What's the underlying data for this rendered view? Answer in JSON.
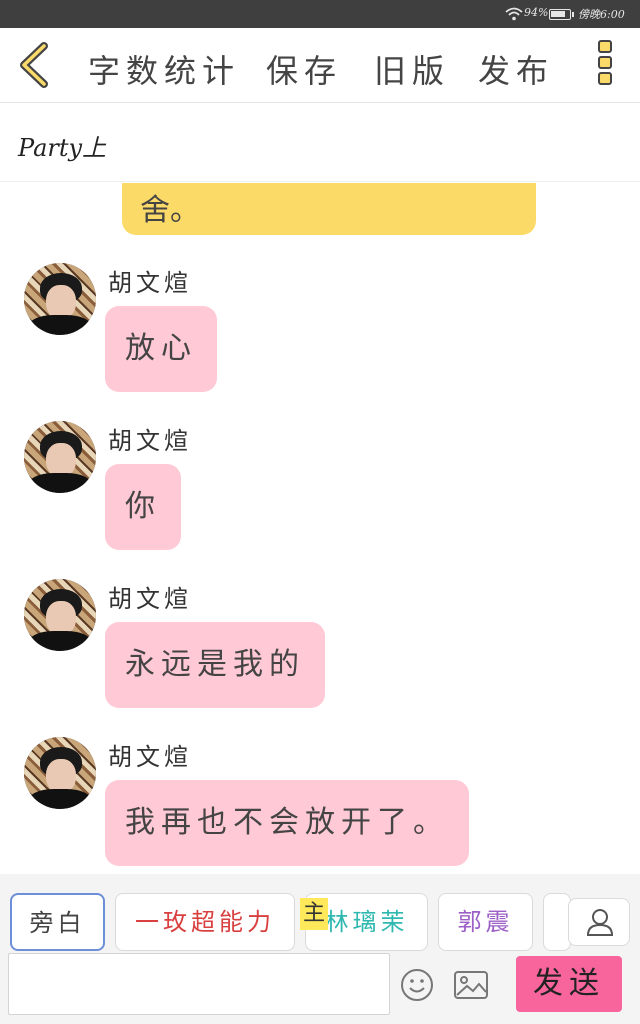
{
  "status_bar": {
    "battery_percent": "94%",
    "time": "傍晚6:00"
  },
  "toolbar": {
    "back_icon": "chevron-left-icon",
    "word_count_label": "字数统计",
    "save_label": "保存",
    "old_version_label": "旧版",
    "publish_label": "发布",
    "menu_icon": "more-vertical-icon"
  },
  "story": {
    "title": "Party上"
  },
  "accent": {
    "yellow": "#fcda68",
    "pink_bubble": "#ffc9d6",
    "send_button": "#f8649c"
  },
  "chat": {
    "previous_bubble_text": "舍。",
    "messages": [
      {
        "sender": "胡文煊",
        "text": "放心"
      },
      {
        "sender": "胡文煊",
        "text": "你"
      },
      {
        "sender": "胡文煊",
        "text": "永远是我的"
      },
      {
        "sender": "胡文煊",
        "text": "我再也不会放开了。"
      }
    ]
  },
  "characters": {
    "narrator": "旁白",
    "chips": [
      {
        "label": "一玫超能力",
        "color": "#d94040"
      },
      {
        "label": "林璃茉",
        "color": "#2fb8b0",
        "tag": "主"
      },
      {
        "label": "郭震",
        "color": "#9b5fc6"
      }
    ]
  },
  "input": {
    "placeholder": "",
    "send_label": "发送"
  }
}
